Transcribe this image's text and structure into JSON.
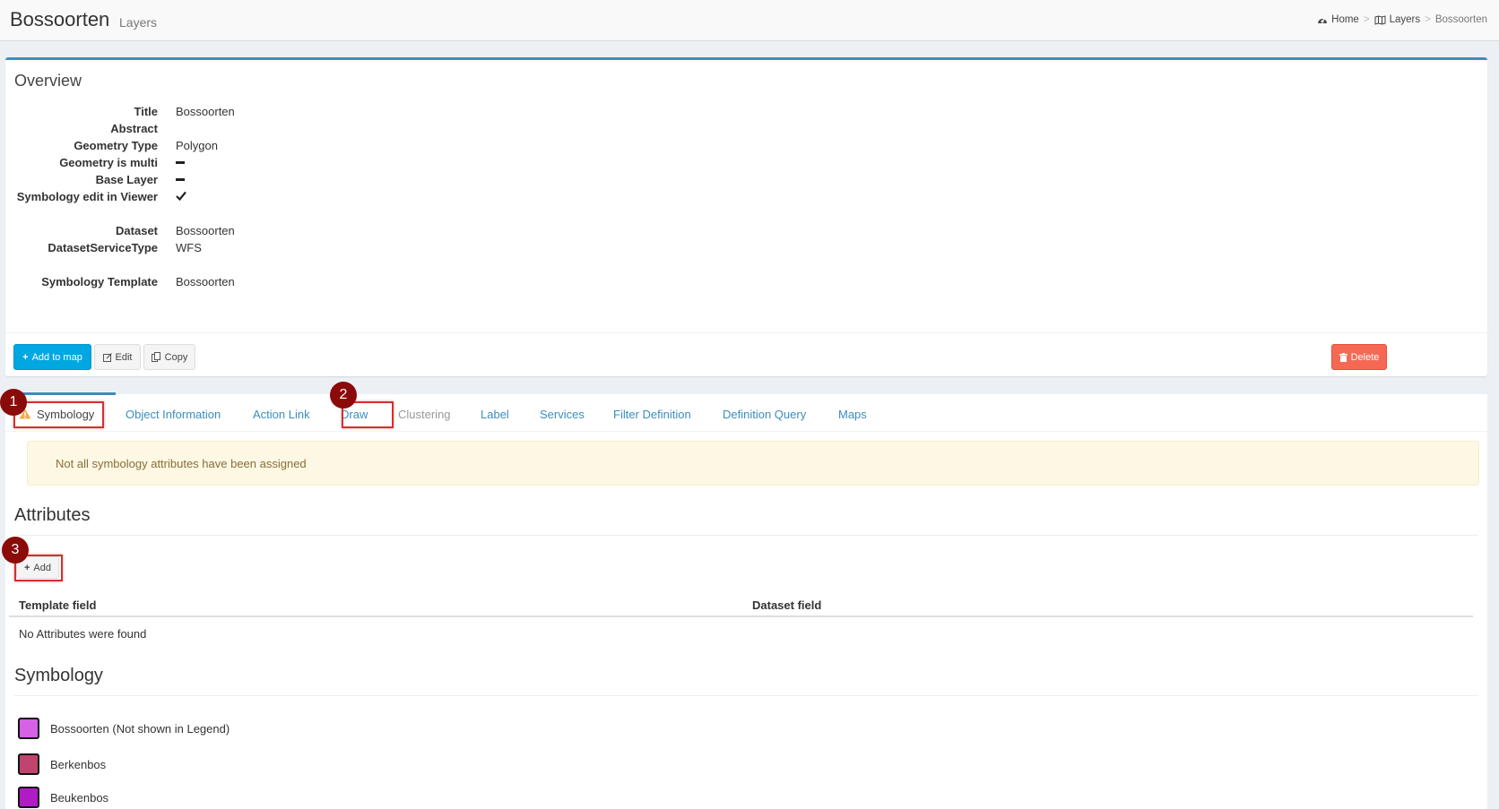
{
  "header": {
    "title": "Bossoorten",
    "subtitle": "Layers",
    "breadcrumb": {
      "home": "Home",
      "layers": "Layers",
      "current": "Bossoorten",
      "separator": ">"
    }
  },
  "overview": {
    "title": "Overview",
    "fields": {
      "title_label": "Title",
      "title_value": "Bossoorten",
      "abstract_label": "Abstract",
      "geometry_type_label": "Geometry Type",
      "geometry_type_value": "Polygon",
      "geometry_multi_label": "Geometry is multi",
      "base_layer_label": "Base Layer",
      "symbology_edit_label": "Symbology edit in Viewer",
      "dataset_label": "Dataset",
      "dataset_value": "Bossoorten",
      "dataset_service_type_label": "DatasetServiceType",
      "dataset_service_type_value": "WFS",
      "symbology_template_label": "Symbology Template",
      "symbology_template_value": "Bossoorten"
    },
    "buttons": {
      "add_to_map": "Add to map",
      "edit": "Edit",
      "copy": "Copy",
      "delete": "Delete"
    }
  },
  "tabs": {
    "symbology": "Symbology",
    "object_information": "Object Information",
    "action_link": "Action Link",
    "draw": "Draw",
    "clustering": "Clustering",
    "label": "Label",
    "services": "Services",
    "filter_definition": "Filter Definition",
    "definition_query": "Definition Query",
    "maps": "Maps"
  },
  "warning": "Not all symbology attributes have been assigned",
  "attributes": {
    "title": "Attributes",
    "add_button": "Add",
    "columns": [
      "Template field",
      "Dataset field"
    ],
    "empty": "No Attributes were found"
  },
  "symbology": {
    "title": "Symbology",
    "items": [
      {
        "label": "Bossoorten (Not shown in Legend)",
        "color": "#d660e6"
      },
      {
        "label": "Berkenbos",
        "color": "#c0446f"
      },
      {
        "label": "Beukenbos",
        "color": "#b01bc4"
      }
    ]
  },
  "annotations": [
    "1",
    "2",
    "3"
  ],
  "colors": {
    "primary": "#00a7e0",
    "danger": "#f56954",
    "link": "#3c8dbc",
    "warning_bg": "#fcf8e3",
    "annotation": "#8b0a0a"
  }
}
